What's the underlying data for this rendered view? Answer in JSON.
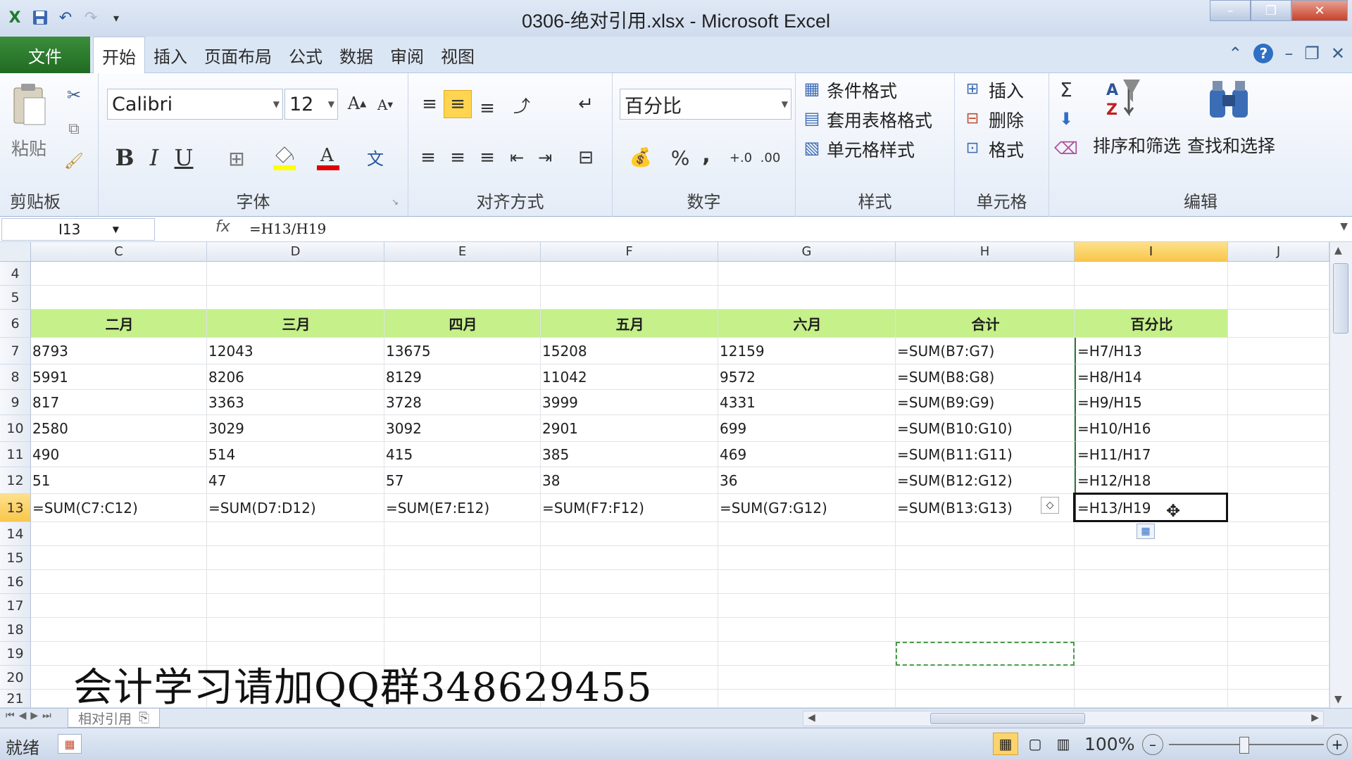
{
  "window": {
    "title": "0306-绝对引用.xlsx - Microsoft Excel"
  },
  "menu": {
    "file": "文件",
    "tabs": [
      "开始",
      "插入",
      "页面布局",
      "公式",
      "数据",
      "审阅",
      "视图"
    ]
  },
  "ribbon": {
    "clipboard": {
      "label": "剪贴板",
      "paste": "粘贴"
    },
    "font": {
      "label": "字体",
      "name": "Calibri",
      "size": "12",
      "bold": "B",
      "italic": "I",
      "underline": "U"
    },
    "alignment": {
      "label": "对齐方式"
    },
    "number": {
      "label": "数字",
      "format": "百分比",
      "percent": "%",
      "comma": ","
    },
    "styles": {
      "label": "样式",
      "cond_format": "条件格式",
      "table_format": "套用表格格式",
      "cell_style": "单元格样式"
    },
    "cells": {
      "label": "单元格",
      "insert": "插入",
      "delete": "删除",
      "format": "格式"
    },
    "editing": {
      "label": "编辑",
      "sort": "排序和筛选",
      "find": "查找和选择"
    }
  },
  "formula_bar": {
    "name_box": "I13",
    "fx": "fx",
    "formula": "=H13/H19"
  },
  "columns": [
    {
      "letter": "C"
    },
    {
      "letter": "D"
    },
    {
      "letter": "E"
    },
    {
      "letter": "F"
    },
    {
      "letter": "G"
    },
    {
      "letter": "H"
    },
    {
      "letter": "I"
    },
    {
      "letter": "J"
    }
  ],
  "rows": [
    "4",
    "5",
    "6",
    "7",
    "8",
    "9",
    "10",
    "11",
    "12",
    "13",
    "14",
    "15",
    "16",
    "17",
    "18",
    "19",
    "20",
    "21"
  ],
  "table": {
    "headers": [
      "二月",
      "三月",
      "四月",
      "五月",
      "六月",
      "合计",
      "百分比"
    ],
    "body": [
      [
        "8793",
        "12043",
        "13675",
        "15208",
        "12159",
        "=SUM(B7:G7)",
        "=H7/H13"
      ],
      [
        "5991",
        "8206",
        "8129",
        "11042",
        "9572",
        "=SUM(B8:G8)",
        "=H8/H14"
      ],
      [
        "817",
        "3363",
        "3728",
        "3999",
        "4331",
        "=SUM(B9:G9)",
        "=H9/H15"
      ],
      [
        "2580",
        "3029",
        "3092",
        "2901",
        "699",
        "=SUM(B10:G10)",
        "=H10/H16"
      ],
      [
        "490",
        "514",
        "415",
        "385",
        "469",
        "=SUM(B11:G11)",
        "=H11/H17"
      ],
      [
        "51",
        "47",
        "57",
        "38",
        "36",
        "=SUM(B12:G12)",
        "=H12/H18"
      ],
      [
        "=SUM(C7:C12)",
        "=SUM(D7:D12)",
        "=SUM(E7:E12)",
        "=SUM(F7:F12)",
        "=SUM(G7:G12)",
        "=SUM(B13:G13)",
        "=H13/H19"
      ]
    ]
  },
  "sheet": {
    "name": "相对引用"
  },
  "status": {
    "ready": "就绪",
    "zoom": "100%"
  },
  "overlay": {
    "watermark": "会计学习请加QQ群348629455"
  },
  "colors": {
    "header_fill": "#c5f08a",
    "selection": "#f8c64b",
    "file_tab": "#2b7a2b"
  }
}
